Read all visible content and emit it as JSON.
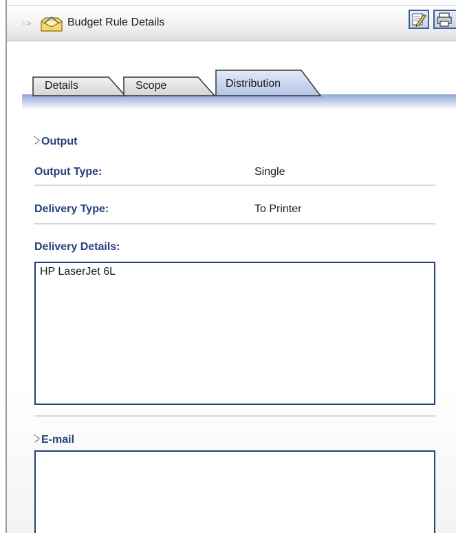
{
  "window": {
    "title": "Budget Rule Details",
    "title_icon": "folder-envelope-icon",
    "edit_icon": "edit-pencil-icon",
    "print_icon": "printer-icon"
  },
  "tabs": [
    {
      "label": "Details",
      "active": false
    },
    {
      "label": "Scope",
      "active": false
    },
    {
      "label": "Distribution",
      "active": true
    }
  ],
  "output": {
    "header": "Output",
    "output_type_label": "Output Type:",
    "output_type_value": "Single",
    "delivery_type_label": "Delivery Type:",
    "delivery_type_value": "To Printer",
    "delivery_details_label": "Delivery Details:",
    "delivery_details_value": "HP LaserJet 6L"
  },
  "email": {
    "header": "E-mail",
    "value": ""
  },
  "colors": {
    "label_blue": "#243f7a",
    "tab_active": "#c9d6ef",
    "tab_inactive": "#e6e6e6",
    "tab_strip": "#9fb5df"
  }
}
